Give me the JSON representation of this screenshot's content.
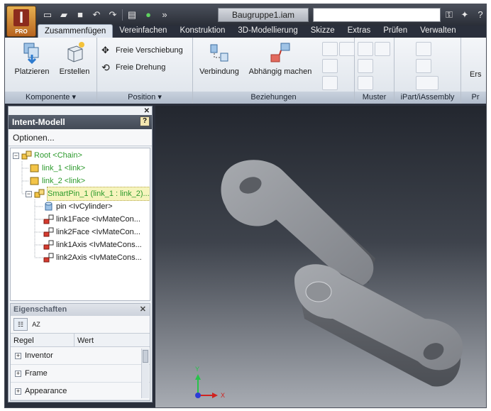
{
  "app": {
    "badge": "PRO",
    "document_title": "Baugruppe1.iam",
    "search_placeholder": ""
  },
  "tabs": [
    "Zusammenfügen",
    "Vereinfachen",
    "Konstruktion",
    "3D-Modellierung",
    "Skizze",
    "Extras",
    "Prüfen",
    "Verwalten"
  ],
  "ribbon": {
    "komponente": {
      "title": "Komponente",
      "place": "Platzieren",
      "create": "Erstellen"
    },
    "position": {
      "title": "Position",
      "free_move": "Freie Verschiebung",
      "free_rotate": "Freie Drehung"
    },
    "beziehungen": {
      "title": "Beziehungen",
      "joint": "Verbindung",
      "constrain": "Abhängig machen"
    },
    "muster": {
      "title": "Muster"
    },
    "ipart": {
      "title": "iPart/iAssembly"
    },
    "cut": {
      "label": "Ers",
      "title": "Pr"
    }
  },
  "browser": {
    "title": "Intent-Modell",
    "help": "?",
    "options": "Optionen...",
    "tree": [
      {
        "label": "Root <Chain>"
      },
      {
        "label": "link_1 <link>"
      },
      {
        "label": "link_2 <link>"
      },
      {
        "label": "SmartPin_1 (link_1 : link_2)..."
      },
      {
        "label": "pin <IvCylinder>"
      },
      {
        "label": "link1Face <IvMateCon..."
      },
      {
        "label": "link2Face <IvMateCon..."
      },
      {
        "label": "link1Axis <IvMateCons..."
      },
      {
        "label": "link2Axis <IvMateCons..."
      }
    ]
  },
  "properties": {
    "title": "Eigenschaften",
    "col_rule": "Regel",
    "col_value": "Wert",
    "sort_label": "AZ",
    "rows": [
      "Inventor",
      "Frame",
      "Appearance"
    ]
  },
  "axes": {
    "x": "X",
    "y": "Y"
  },
  "colors": {
    "accent_green": "#2c9a2c",
    "ribbon_bg": "#e8edf3",
    "titlebar": "#2a2e37",
    "model_gray": "#8d9096"
  }
}
